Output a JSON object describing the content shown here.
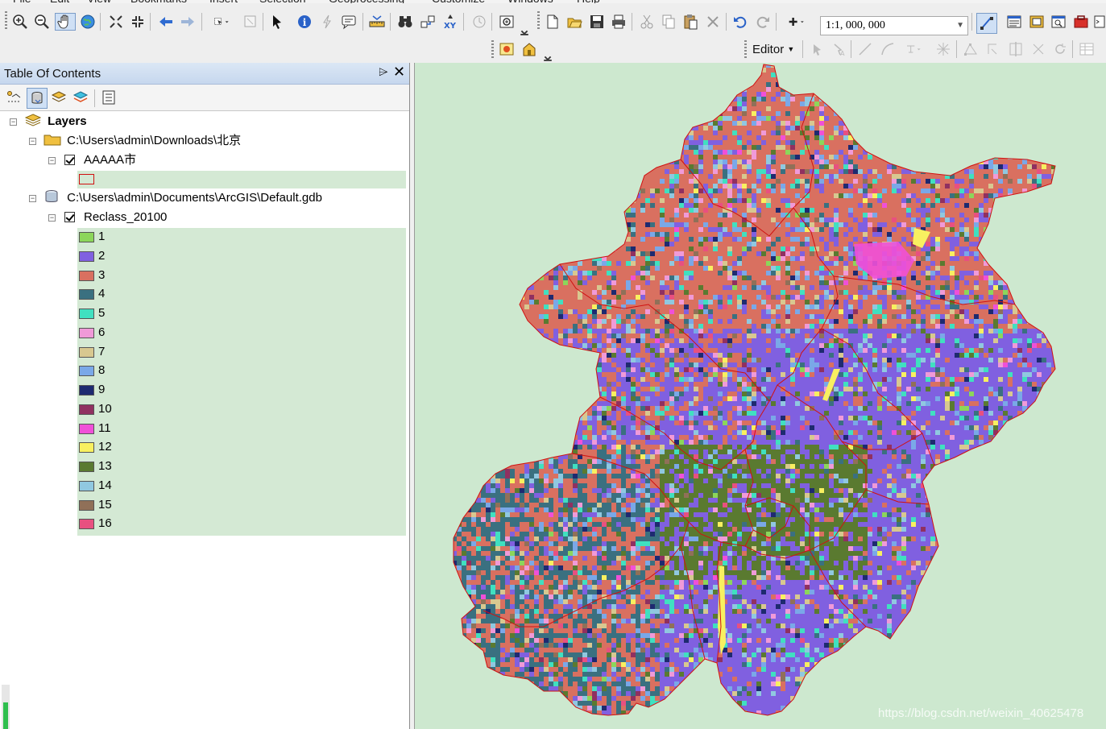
{
  "menu": [
    "File",
    "Edit",
    "View",
    "Bookmarks",
    "Insert",
    "Selection",
    "Geoprocessing",
    "Customize",
    "Windows",
    "Help"
  ],
  "toolbar": {
    "scale_value": "1:1, 000, 000",
    "editor_label": "Editor"
  },
  "toc": {
    "title": "Table Of Contents",
    "pin_glyph": "⌲",
    "close_glyph": "✕",
    "root_label": "Layers",
    "group1_path": "C:\\Users\\admin\\Downloads\\北京",
    "layer1_name": "AAAAA市",
    "group2_path": "C:\\Users\\admin\\Documents\\ArcGIS\\Default.gdb",
    "layer2_name": "Reclass_20100",
    "legend": [
      {
        "label": "1",
        "color": "#8cd65a"
      },
      {
        "label": "2",
        "color": "#8060e0"
      },
      {
        "label": "3",
        "color": "#d97060"
      },
      {
        "label": "4",
        "color": "#3a7080"
      },
      {
        "label": "5",
        "color": "#40e0c0"
      },
      {
        "label": "6",
        "color": "#f09ad8"
      },
      {
        "label": "7",
        "color": "#d8c890"
      },
      {
        "label": "8",
        "color": "#7aa8e8"
      },
      {
        "label": "9",
        "color": "#1e2a70"
      },
      {
        "label": "10",
        "color": "#903060"
      },
      {
        "label": "11",
        "color": "#f050d8"
      },
      {
        "label": "12",
        "color": "#f8f060"
      },
      {
        "label": "13",
        "color": "#5a7a30"
      },
      {
        "label": "14",
        "color": "#90c8e0"
      },
      {
        "label": "15",
        "color": "#907058"
      },
      {
        "label": "16",
        "color": "#e85080"
      }
    ]
  },
  "map": {
    "background_color": "#cde8cf",
    "boundary_color": "#d01010",
    "watermark": "https://blog.csdn.net/weixin_40625478"
  }
}
